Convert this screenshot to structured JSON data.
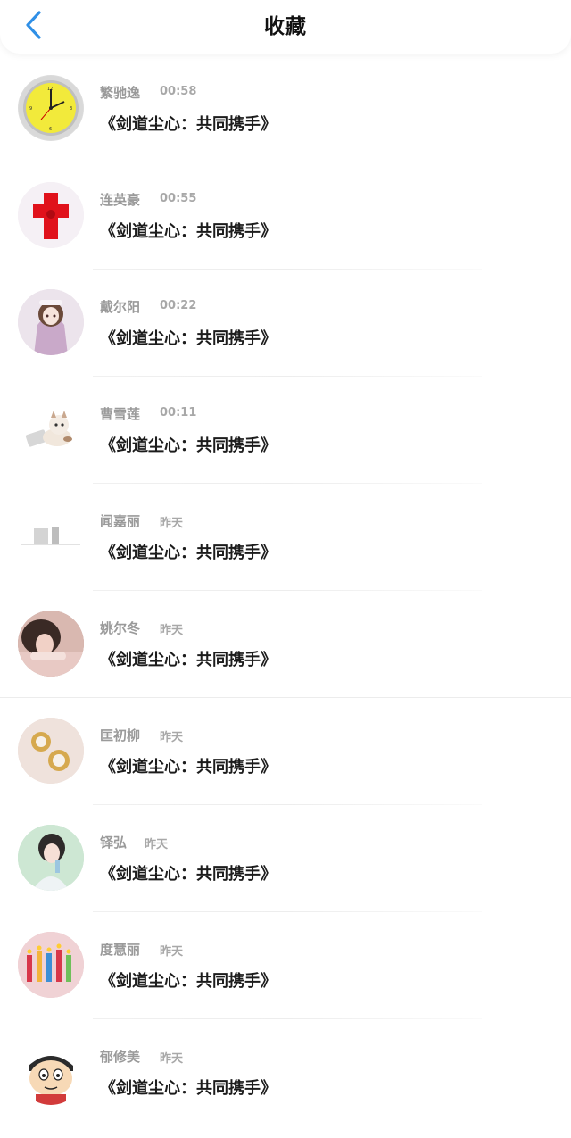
{
  "header": {
    "title": "收藏",
    "back_icon": "chevron-left-icon",
    "accent_color": "#2f8fe6"
  },
  "items": [
    {
      "name": "繁驰逸",
      "time": "00:58",
      "message": "《剑道尘心：共同携手》",
      "avatar": "clock-avatar"
    },
    {
      "name": "连英豪",
      "time": "00:55",
      "message": "《剑道尘心：共同携手》",
      "avatar": "red-cross-avatar"
    },
    {
      "name": "戴尔阳",
      "time": "00:22",
      "message": "《剑道尘心：共同携手》",
      "avatar": "anime-girl-avatar"
    },
    {
      "name": "曹雪莲",
      "time": "00:11",
      "message": "《剑道尘心：共同携手》",
      "avatar": "cat-laptop-avatar"
    },
    {
      "name": "闻嘉丽",
      "time": "昨天",
      "message": "《剑道尘心：共同携手》",
      "avatar": "sketch-avatar"
    },
    {
      "name": "姚尔冬",
      "time": "昨天",
      "message": "《剑道尘心：共同携手》",
      "avatar": "girl-photo-avatar"
    },
    {
      "name": "匡初柳",
      "time": "昨天",
      "message": "《剑道尘心：共同携手》",
      "avatar": "pearl-earring-avatar"
    },
    {
      "name": "铎弘",
      "time": "昨天",
      "message": "《剑道尘心：共同携手》",
      "avatar": "girl-drink-avatar"
    },
    {
      "name": "度慧丽",
      "time": "昨天",
      "message": "《剑道尘心：共同携手》",
      "avatar": "candles-avatar"
    },
    {
      "name": "郁修美",
      "time": "昨天",
      "message": "《剑道尘心：共同携手》",
      "avatar": "cartoon-boy-avatar"
    }
  ]
}
